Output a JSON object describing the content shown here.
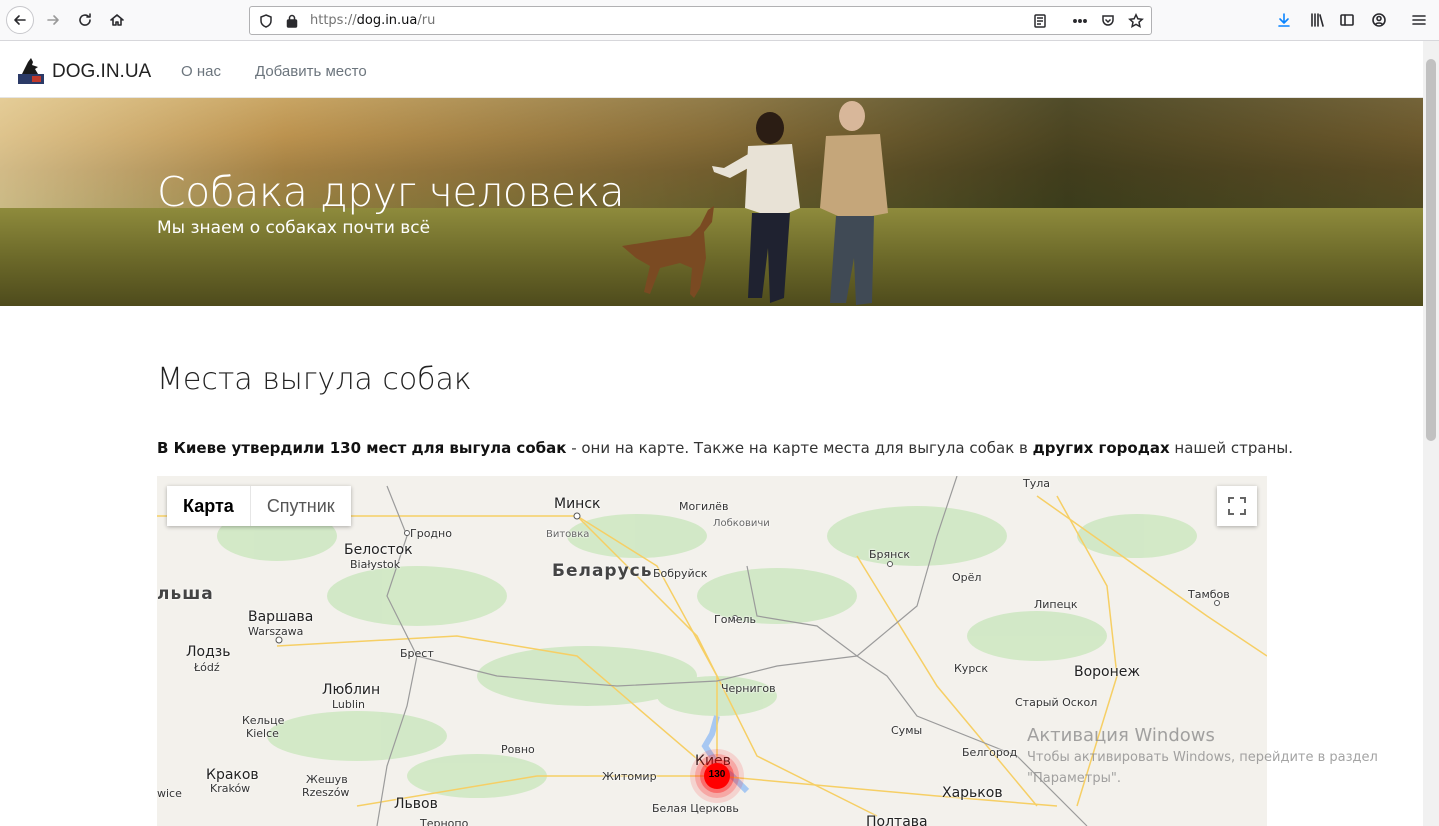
{
  "browser": {
    "url_prefix": "https://",
    "url_domain": "dog.in.ua",
    "url_path": "/ru"
  },
  "site": {
    "brand": "DOG.IN.UA",
    "nav": [
      {
        "label": "О нас"
      },
      {
        "label": "Добавить место"
      }
    ]
  },
  "hero": {
    "title": "Собака друг человека",
    "subtitle": "Мы знаем о собаках почти всё"
  },
  "content": {
    "heading": "Места выгула собак",
    "para_bold1": "В Киеве утвердили 130 мест для выгула собак",
    "para_text1": " - они на карте. Также на карте места для выгула собак в ",
    "para_bold2": "других городах",
    "para_text2": " нашей страны."
  },
  "map": {
    "type_map": "Карта",
    "type_satellite": "Спутник",
    "cluster_count": "130",
    "labels": {
      "minsk": "Минск",
      "mogilev": "Могилёв",
      "vitebsk_sub": "Витовка",
      "lokob": "Лобковичи",
      "grodno": "Гродно",
      "belostok": "Белосток",
      "bialystok": "Białystok",
      "belarus": "Беларусь",
      "bobruisk": "Бобруйск",
      "polsha": "льша",
      "warsaw": "Варшава",
      "warszawa": "Warszawa",
      "gomel": "Гомель",
      "brest": "Брест",
      "lodz": "Лодзь",
      "lodz_pl": "Łódź",
      "lublin": "Люблин",
      "lublin_pl": "Lublin",
      "chernigov": "Чернигов",
      "kielce": "Кельце",
      "kielce_pl": "Kielce",
      "rovno": "Ровно",
      "kiev": "Киев",
      "zhitomir": "Житомир",
      "krakow": "Краков",
      "krakow_pl": "Kraków",
      "wice": "wice",
      "rzeszow": "Жешув",
      "rzeszow_pl": "Rzeszów",
      "lviv": "Львов",
      "belaya": "Белая Церковь",
      "tula": "Тула",
      "bryansk": "Брянск",
      "orel": "Орёл",
      "lipetsk": "Липецк",
      "tambov": "Тамбов",
      "kursk": "Курск",
      "voronezh": "Воронеж",
      "stary_oskol": "Старый Оскол",
      "sumy": "Сумы",
      "belgorod": "Белгород",
      "kharkov": "Харьков",
      "poltava": "Полтава",
      "ternopol": "Тернопо"
    }
  },
  "watermark": {
    "line1": "Активация Windows",
    "line2": "Чтобы активировать Windows, перейдите в раздел",
    "line3": "\"Параметры\"."
  }
}
